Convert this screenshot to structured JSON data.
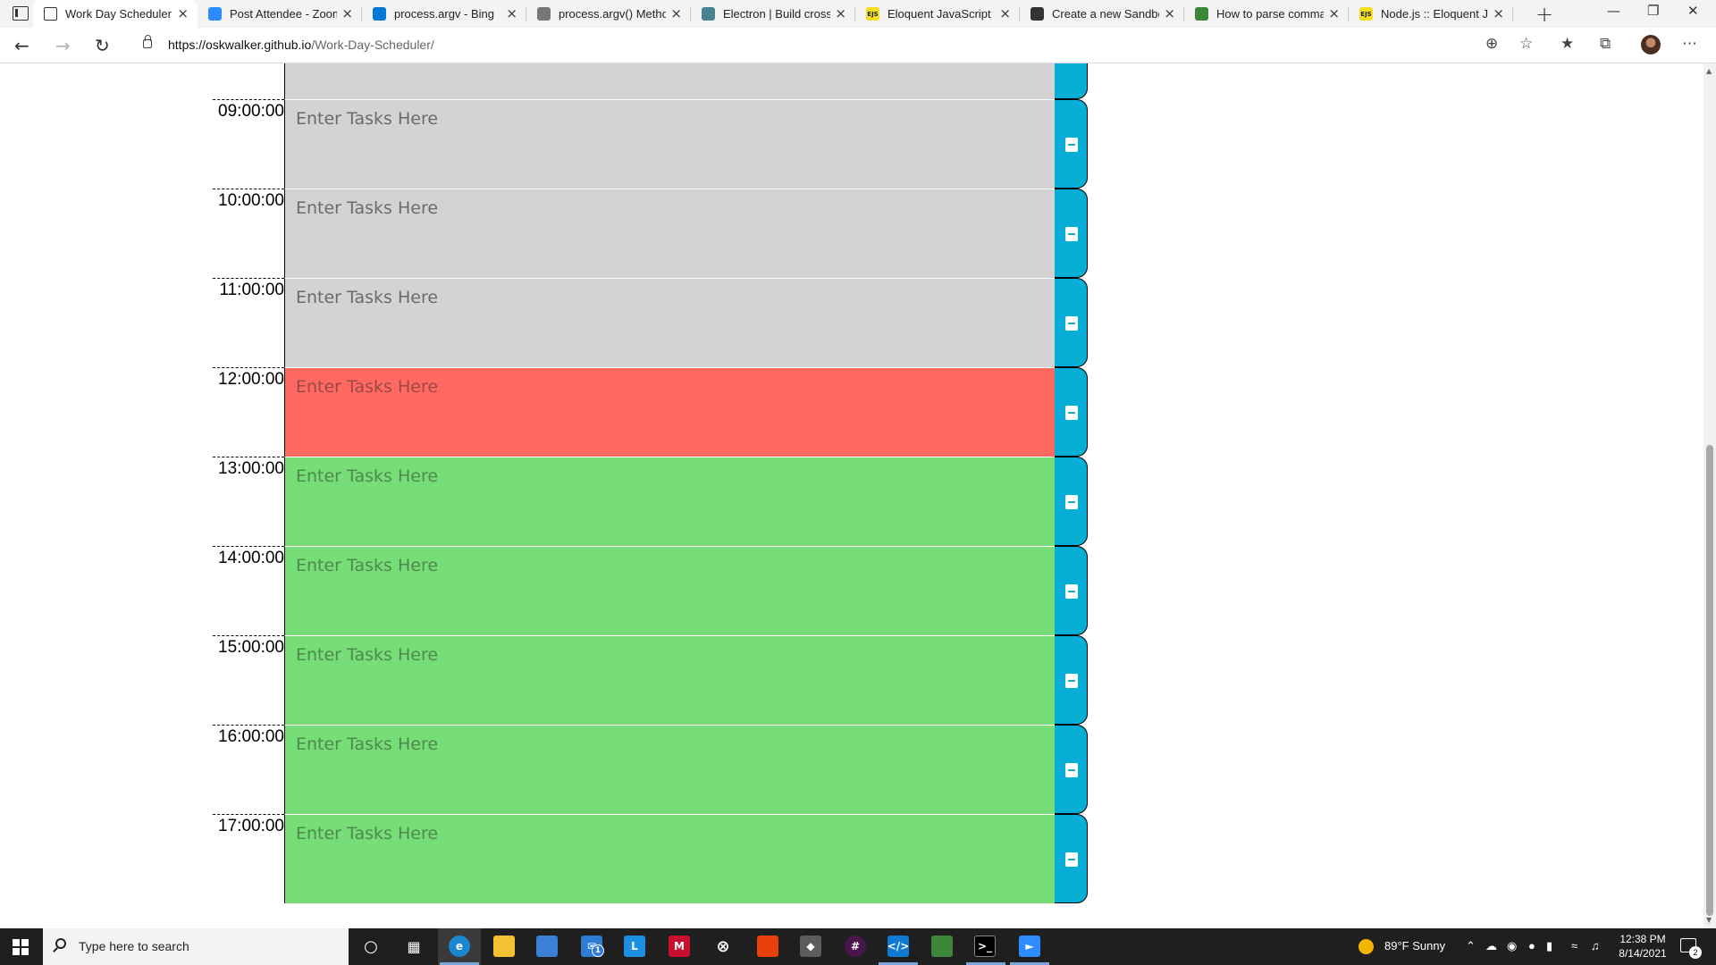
{
  "browser": {
    "tabs": [
      {
        "title": "Work Day Scheduler",
        "active": true,
        "favicon": "page-icon",
        "favicon_color": "#ffffff"
      },
      {
        "title": "Post Attendee - Zoom",
        "active": false,
        "favicon": "zoom-icon",
        "favicon_color": "#2d8cff"
      },
      {
        "title": "process.argv - Bing",
        "active": false,
        "favicon": "bing-icon",
        "favicon_color": "#0078d4"
      },
      {
        "title": "process.argv() Method",
        "active": false,
        "favicon": "gear-site-icon",
        "favicon_color": "#777777"
      },
      {
        "title": "Electron | Build cross-p",
        "active": false,
        "favicon": "electron-icon",
        "favicon_color": "#47848f"
      },
      {
        "title": "Eloquent JavaScript",
        "active": false,
        "favicon": "ejs-icon",
        "favicon_color": "#f7df1e"
      },
      {
        "title": "Create a new Sandbox",
        "active": false,
        "favicon": "codesandbox-icon",
        "favicon_color": "#333333"
      },
      {
        "title": "How to parse comman",
        "active": false,
        "favicon": "node-icon",
        "favicon_color": "#3c873a"
      },
      {
        "title": "Node.js :: Eloquent Jav",
        "active": false,
        "favicon": "ejs-icon",
        "favicon_color": "#f7df1e"
      }
    ],
    "url": {
      "host": "https://oskwalker.github.io",
      "path": "/Work-Day-Scheduler/"
    }
  },
  "scheduler": {
    "placeholder": "Enter Tasks Here",
    "colors": {
      "past": "#d3d3d3",
      "present": "#ff6961",
      "future": "#77dd77",
      "save": "#06aed5"
    },
    "rows": [
      {
        "hour": "",
        "state": "past",
        "value": ""
      },
      {
        "hour": "09:00:00",
        "state": "past",
        "value": ""
      },
      {
        "hour": "10:00:00",
        "state": "past",
        "value": ""
      },
      {
        "hour": "11:00:00",
        "state": "past",
        "value": ""
      },
      {
        "hour": "12:00:00",
        "state": "present",
        "value": ""
      },
      {
        "hour": "13:00:00",
        "state": "future",
        "value": ""
      },
      {
        "hour": "14:00:00",
        "state": "future",
        "value": ""
      },
      {
        "hour": "15:00:00",
        "state": "future",
        "value": ""
      },
      {
        "hour": "16:00:00",
        "state": "future",
        "value": ""
      },
      {
        "hour": "17:00:00",
        "state": "future",
        "value": ""
      }
    ]
  },
  "taskbar": {
    "search_placeholder": "Type here to search",
    "weather": "89°F  Sunny",
    "time": "12:38 PM",
    "date": "8/14/2021",
    "mail_badge": "1",
    "notification_count": "2"
  }
}
